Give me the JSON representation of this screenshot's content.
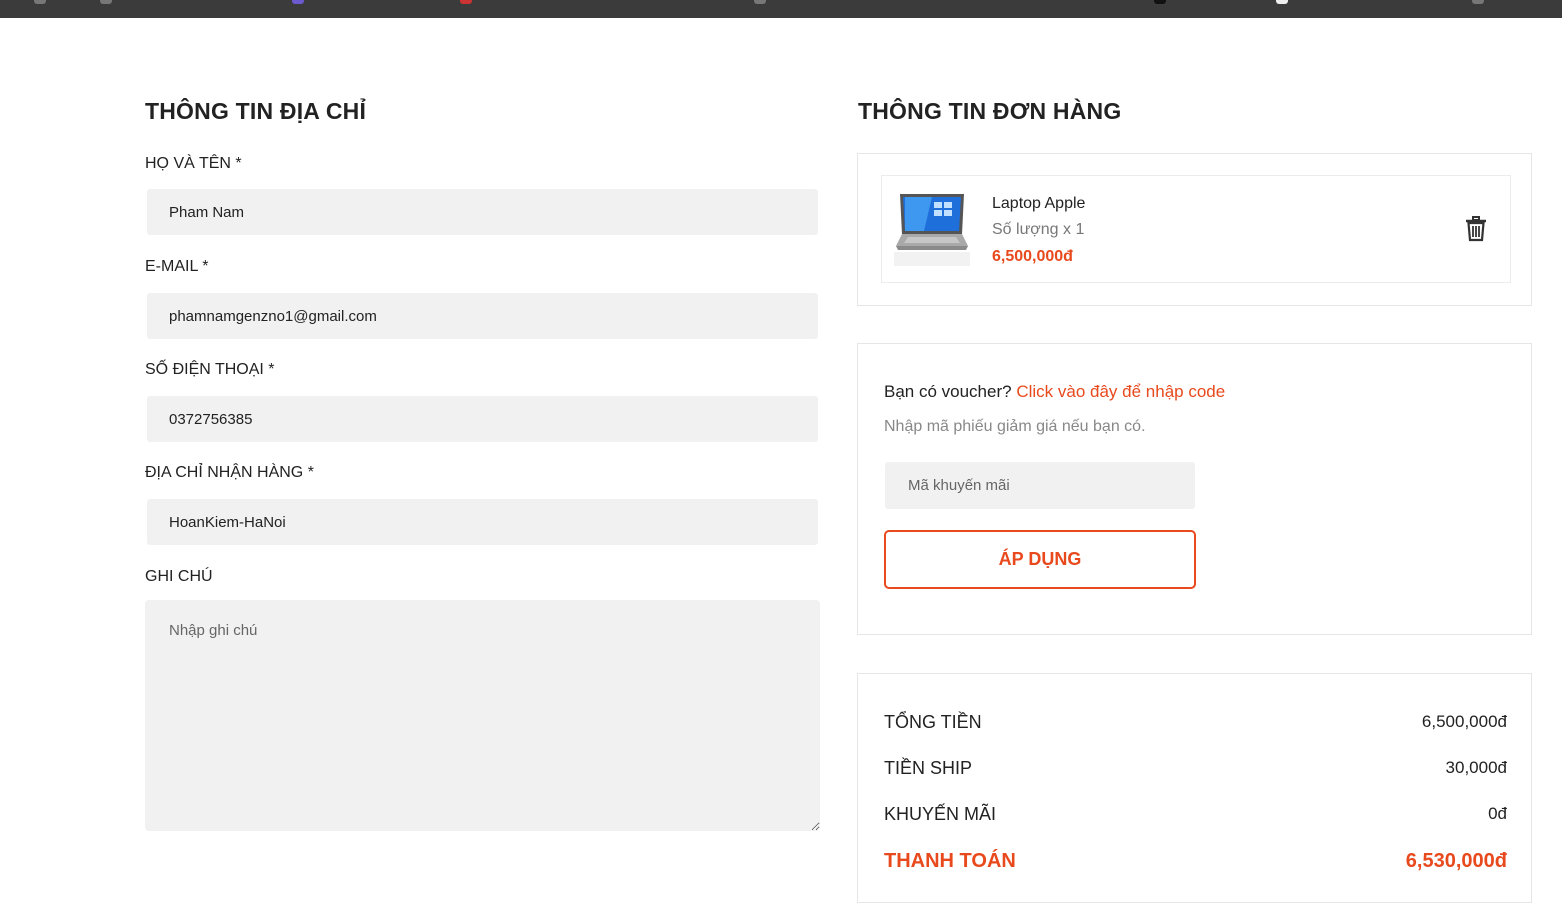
{
  "colors": {
    "accent": "#e8491d",
    "input_bg": "#f1f1f1",
    "topbar": "#3b3b3b",
    "text": "#222222",
    "muted": "#888888",
    "border": "#e6e6e6"
  },
  "address": {
    "title": "THÔNG TIN ĐỊA CHỈ",
    "fullname": {
      "label": "HỌ VÀ TÊN *",
      "value": "Pham Nam"
    },
    "email": {
      "label": "E-MAIL *",
      "value": "phamnamgenzno1@gmail.com"
    },
    "phone": {
      "label": "SỐ ĐIỆN THOẠI *",
      "value": "0372756385"
    },
    "shipping_address": {
      "label": "ĐỊA CHỈ NHẬN HÀNG *",
      "value": "HoanKiem-HaNoi"
    },
    "note": {
      "label": "GHI CHÚ",
      "placeholder": "Nhập ghi chú",
      "value": ""
    }
  },
  "order": {
    "title": "THÔNG TIN ĐƠN HÀNG",
    "items": [
      {
        "name": "Laptop Apple",
        "quantity_text": "Số lượng x 1",
        "price": "6,500,000đ",
        "thumbnail_icon": "laptop-image",
        "remove_icon": "trash-icon"
      }
    ]
  },
  "voucher": {
    "question": "Bạn có voucher?",
    "link_text": "Click vào đây để nhập code",
    "hint": "Nhập mã phiếu giảm giá nếu bạn có.",
    "input_placeholder": "Mã khuyến mãi",
    "input_value": "",
    "apply_label": "ÁP DỤNG"
  },
  "summary": {
    "subtotal": {
      "label": "TỔNG TIỀN",
      "value": "6,500,000đ"
    },
    "shipping": {
      "label": "TIỀN SHIP",
      "value": "30,000đ"
    },
    "discount": {
      "label": "KHUYẾN MÃI",
      "value": "0đ"
    },
    "total": {
      "label": "THANH TOÁN",
      "value": "6,530,000đ"
    }
  }
}
